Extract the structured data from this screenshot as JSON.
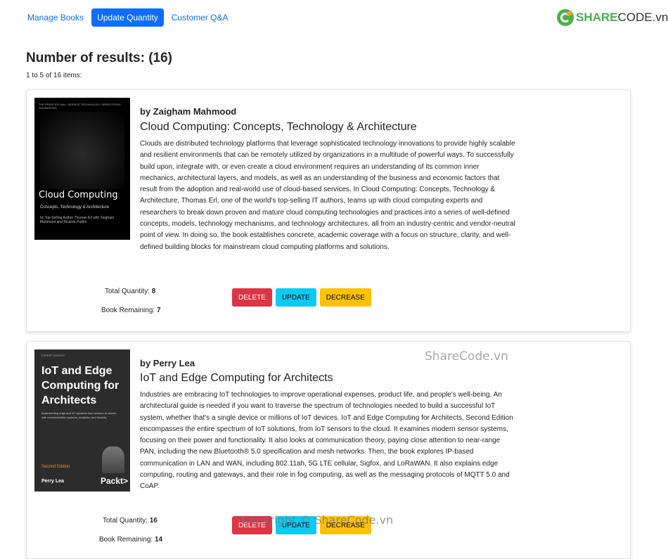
{
  "nav": {
    "items": [
      {
        "label": "Manage Books",
        "active": false
      },
      {
        "label": "Update Quantity",
        "active": true
      },
      {
        "label": "Customer Q&A",
        "active": false
      }
    ]
  },
  "logo": {
    "bold": "SHARE",
    "light": "CODE.vn"
  },
  "results": {
    "heading": "Number of results: (16)",
    "range": "1 to 5 of 16 items:"
  },
  "books": [
    {
      "cover": {
        "series": "THE PRENTICE HALL SERVICE TECHNOLOGY SERIES FROM THOMAS ERL",
        "title": "Cloud Computing",
        "subtitle": "Concepts, Technology & Architecture",
        "authors": "by Top-Selling Author Thomas Erl with Zaigham Mahmood and Ricardo Puttini"
      },
      "author": "by Zaigham Mahmood",
      "title": "Cloud Computing: Concepts, Technology & Architecture",
      "description": "Clouds are distributed technology platforms that leverage sophisticated technology innovations to provide highly scalable and resilient environments that can be remotely utilized by organizations in a multitude of powerful ways. To successfully build upon, integrate with, or even create a cloud environment requires an understanding of its common inner mechanics, architectural layers, and models, as well as an understanding of the business and economic factors that result from the adoption and real-world use of cloud-based services. In Cloud Computing: Concepts, Technology & Architecture, Thomas Erl, one of the world's top-selling IT authors, teams up with cloud computing experts and researchers to break down proven and mature cloud computing technologies and practices into a series of well-defined concepts, models, technology mechanisms, and technology architectures, all from an industry-centric and vendor-neutral point of view. In doing so, the book establishes concrete, academic coverage with a focus on structure, clarity, and well-defined building blocks for mainstream cloud computing platforms and solutions.",
      "total_label": "Total Quantity:",
      "total": "8",
      "remaining_label": "Book Remaining:",
      "remaining": "7"
    },
    {
      "cover": {
        "badge": "EXPERT INSIGHT",
        "title": "IoT and Edge Computing for Architects",
        "subtitle": "Implementing edge and IoT systems from sensors to clouds with communication systems, analytics, and security",
        "edition": "Second Edition",
        "author": "Perry Lea",
        "publisher": "Packt>"
      },
      "author": "by Perry Lea",
      "title": "IoT and Edge Computing for Architects",
      "description": "Industries are embracing IoT technologies to improve operational expenses, product life, and people's well-being. An architectural guide is needed if you want to traverse the spectrum of technologies needed to build a successful IoT system, whether that's a single device or millions of IoT devices. IoT and Edge Computing for Architects, Second Edition encompasses the entire spectrum of IoT solutions, from IoT sensors to the cloud. It examines modern sensor systems, focusing on their power and functionality. It also looks at communication theory, paying close attention to near-range PAN, including the new Bluetooth® 5.0 specification and mesh networks. Then, the book explores IP-based communication in LAN and WAN, including 802.11ah, 5G LTE cellular, Sigfox, and LoRaWAN. It also explains edge computing, routing and gateways, and their role in fog computing, as well as the messaging protocols of MQTT 5.0 and CoAP.",
      "total_label": "Total Quantity:",
      "total": "16",
      "remaining_label": "Book Remaining:",
      "remaining": "14"
    }
  ],
  "buttons": {
    "delete": "DELETE",
    "update": "UPDATE",
    "decrease": "DECREASE"
  },
  "watermarks": {
    "mid": "ShareCode.vn",
    "bottom": "Copyright © ShareCode.vn"
  },
  "colors": {
    "primary": "#0d6efd",
    "danger": "#dc3545",
    "info": "#0dcaf0",
    "warning": "#ffc107"
  }
}
